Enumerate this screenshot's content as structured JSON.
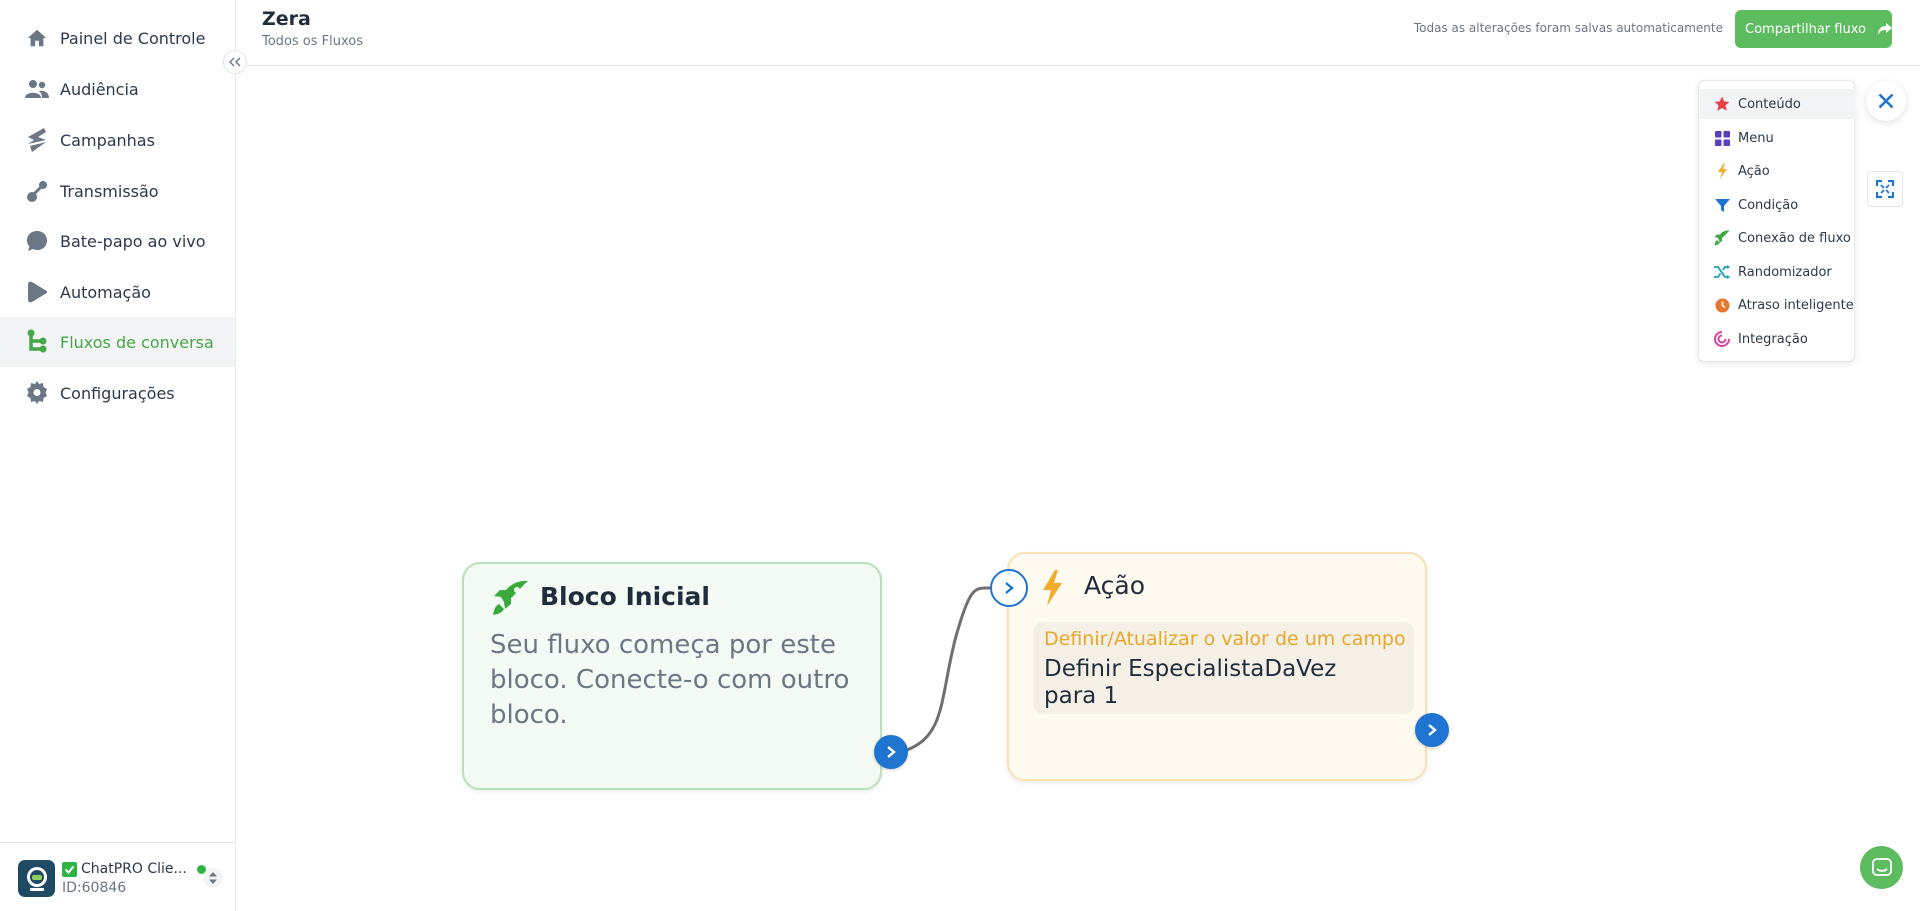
{
  "sidebar": {
    "items": [
      {
        "label": "Painel de Controle",
        "icon": "home-icon"
      },
      {
        "label": "Audiência",
        "icon": "users-icon"
      },
      {
        "label": "Campanhas",
        "icon": "campaign-icon"
      },
      {
        "label": "Transmissão",
        "icon": "broadcast-icon"
      },
      {
        "label": "Bate-papo ao vivo",
        "icon": "chat-bubble-icon"
      },
      {
        "label": "Automação",
        "icon": "play-icon"
      },
      {
        "label": "Fluxos de conversa",
        "icon": "flow-icon",
        "active": true
      },
      {
        "label": "Configurações",
        "icon": "gear-icon"
      }
    ]
  },
  "account": {
    "name": "ChatPRO Clie...",
    "id": "ID:60846"
  },
  "header": {
    "title": "Zera",
    "breadcrumb": "Todos os Fluxos",
    "save_status": "Todas as alterações foram salvas automaticamente",
    "share_label": "Compartilhar fluxo"
  },
  "nodes": {
    "start": {
      "title": "Bloco Inicial",
      "description": "Seu fluxo começa por este bloco. Conecte-o com outro bloco."
    },
    "action": {
      "title": "Ação",
      "action_type": "Definir/Atualizar o valor de um campo",
      "line1": "Definir EspecialistaDaVez",
      "line2": "para 1"
    }
  },
  "add_menu": {
    "items": [
      {
        "label": "Conteúdo",
        "icon": "star-icon"
      },
      {
        "label": "Menu",
        "icon": "grid-icon"
      },
      {
        "label": "Ação",
        "icon": "lightning-icon"
      },
      {
        "label": "Condição",
        "icon": "filter-icon"
      },
      {
        "label": "Conexão de fluxo",
        "icon": "rocket-icon"
      },
      {
        "label": "Randomizador",
        "icon": "shuffle-icon"
      },
      {
        "label": "Atraso inteligente",
        "icon": "clock-icon"
      },
      {
        "label": "Integração",
        "icon": "integration-icon"
      }
    ]
  },
  "colors": {
    "brand_green": "#5cbc5f",
    "active_green": "#45a747",
    "port_blue": "#1f74d1",
    "action_orange": "#e9a62b"
  }
}
